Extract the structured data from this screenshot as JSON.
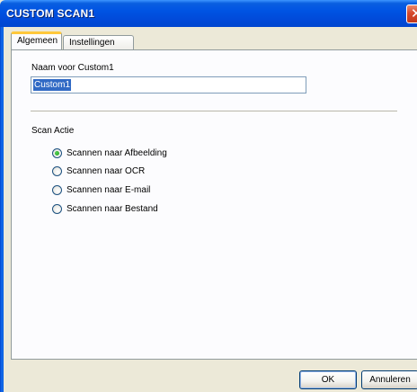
{
  "window": {
    "title": "CUSTOM SCAN1",
    "close_glyph": "✕"
  },
  "tabs": [
    {
      "label": "Algemeen",
      "active": true
    },
    {
      "label": "Instellingen",
      "active": false
    }
  ],
  "name_field": {
    "label": "Naam voor Custom1",
    "value": "Custom1"
  },
  "scan_action": {
    "label": "Scan Actie",
    "options": [
      {
        "label": "Scannen naar Afbeelding",
        "selected": true
      },
      {
        "label": "Scannen naar OCR",
        "selected": false
      },
      {
        "label": "Scannen naar E-mail",
        "selected": false
      },
      {
        "label": "Scannen naar Bestand",
        "selected": false
      }
    ]
  },
  "buttons": {
    "ok": "OK",
    "cancel": "Annuleren"
  },
  "colors": {
    "titlebar": "#0054E3",
    "tab_highlight": "#FFC83C",
    "selection": "#316AC5",
    "radio_dot": "#21A121"
  }
}
